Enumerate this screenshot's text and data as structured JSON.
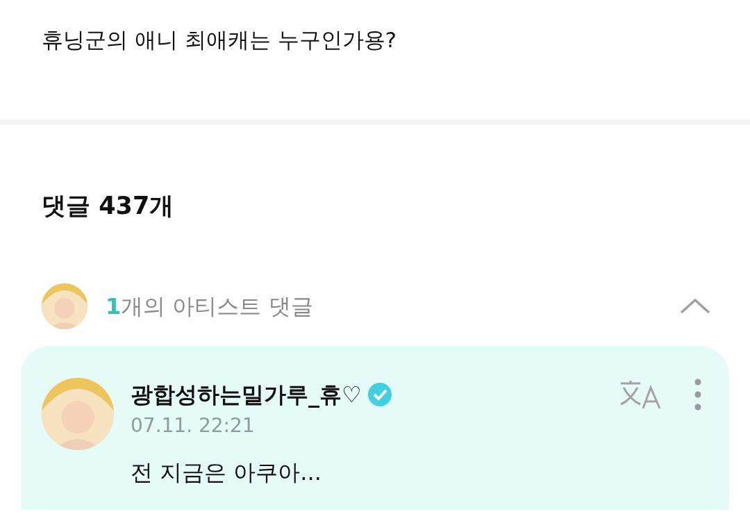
{
  "post": {
    "text": "휴닝군의 애니 최애캐는 누구인가용?"
  },
  "comments_header": {
    "title": "댓글 437개"
  },
  "artist_comments": {
    "count": "1",
    "label": "개의 아티스트 댓글",
    "expanded": true
  },
  "comment": {
    "author": "광합성하는밀가루_휴♡",
    "verified": true,
    "time": "07.11. 22:21",
    "text": "전 지금은 아쿠아..."
  }
}
